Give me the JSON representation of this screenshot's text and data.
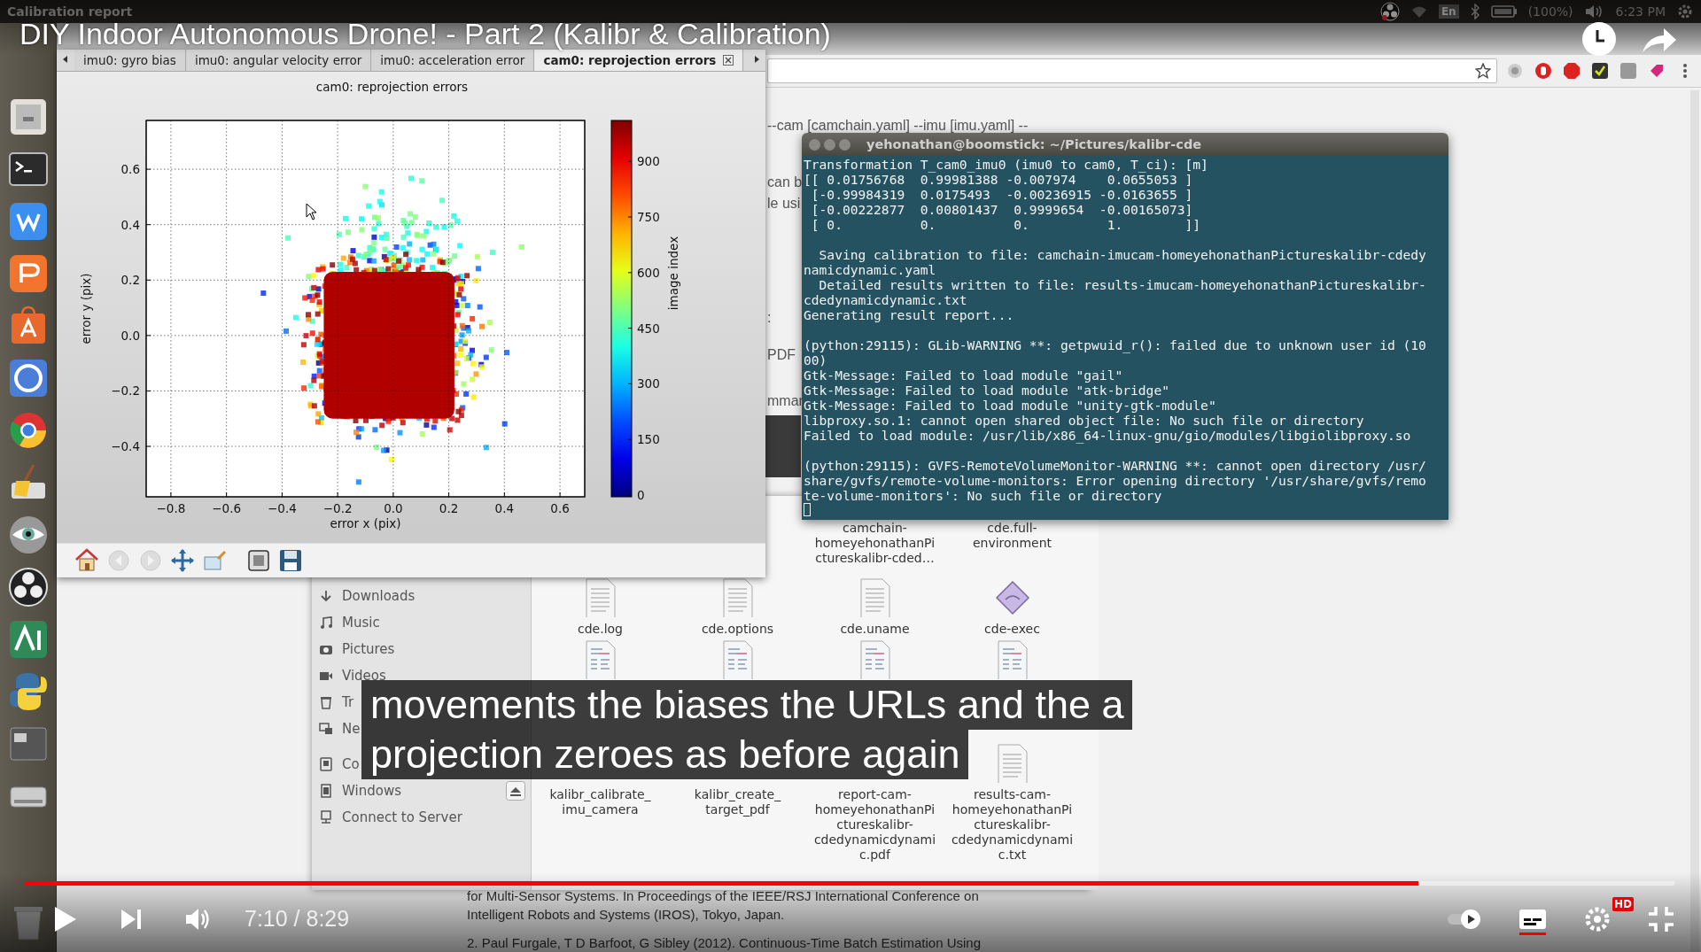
{
  "top_panel": {
    "title": "Calibration report",
    "keyboard": "En",
    "battery": "(100%)",
    "clock": "6:23 PM"
  },
  "video_title": "DIY Indoor Autonomous Drone! - Part 2 (Kalibr & Calibration)",
  "plot_window": {
    "tabs": [
      {
        "label": "imu0: gyro bias",
        "selected": false
      },
      {
        "label": "imu0: angular velocity error",
        "selected": false
      },
      {
        "label": "imu0: acceleration error",
        "selected": false
      },
      {
        "label": "cam0: reprojection errors",
        "selected": true
      }
    ],
    "plot": {
      "title": "cam0: reprojection errors",
      "xlabel": "error x (pix)",
      "ylabel": "error y (pix)",
      "xticks": [
        "−0.8",
        "−0.6",
        "−0.4",
        "−0.2",
        "0.0",
        "0.2",
        "0.4",
        "0.6"
      ],
      "yticks": [
        "0.6",
        "0.4",
        "0.2",
        "0.0",
        "−0.2",
        "−0.4"
      ],
      "colorbar": {
        "label": "image index",
        "ticks": [
          "900",
          "750",
          "600",
          "450",
          "300",
          "150",
          "0"
        ]
      }
    }
  },
  "page_fragments": [
    "--cam [camchain.yaml] --imu [imu.yaml] --",
    "can b",
    "le usi",
    ":",
    "PDF",
    "mmar"
  ],
  "terminal": {
    "title": "yehonathan@boomstick: ~/Pictures/kalibr-cde",
    "blocks": [
      [
        "Transformation T_cam0_imu0 (imu0 to cam0, T_ci): [m]",
        "[[ 0.01756768  0.99981388 -0.007974    0.0655053 ]",
        " [-0.99984319  0.0175493  -0.00236915 -0.0163655 ]",
        " [-0.00222877  0.00801437  0.9999654  -0.00165073]",
        " [ 0.          0.          0.          1.        ]]"
      ],
      [
        "  Saving calibration to file: camchain-imucam-homeyehonathanPictureskalibr-cdedy",
        "namicdynamic.yaml",
        "  Detailed results written to file: results-imucam-homeyehonathanPictureskalibr-",
        "cdedynamicdynamic.txt",
        "Generating result report..."
      ],
      [
        "(python:29115): GLib-WARNING **: getpwuid_r(): failed due to unknown user id (10",
        "00)",
        "Gtk-Message: Failed to load module \"gail\"",
        "Gtk-Message: Failed to load module \"atk-bridge\"",
        "Gtk-Message: Failed to load module \"unity-gtk-module\"",
        "libproxy.so.1: cannot open shared object file: No such file or directory",
        "Failed to load module: /usr/lib/x86_64-linux-gnu/gio/modules/libgiolibproxy.so"
      ],
      [
        "(python:29115): GVFS-RemoteVolumeMonitor-WARNING **: cannot open directory /usr/",
        "share/gvfs/remote-volume-monitors: Error opening directory '/usr/share/gvfs/remo",
        "te-volume-monitors': No such file or directory"
      ]
    ]
  },
  "file_manager": {
    "sidebar": [
      {
        "label": "Downloads",
        "kind": "download"
      },
      {
        "label": "Music",
        "kind": "music"
      },
      {
        "label": "Pictures",
        "kind": "camera"
      },
      {
        "label": "Videos",
        "kind": "video"
      },
      {
        "label": "Tr",
        "kind": "trash"
      },
      {
        "label": "Ne",
        "kind": "network"
      },
      {
        "label": "Co",
        "kind": "computer"
      },
      {
        "label": "Windows",
        "kind": "drive"
      },
      {
        "label": "Connect to Server",
        "kind": "server"
      }
    ],
    "rows": [
      [
        "",
        "",
        {
          "label": [
            "camchain-",
            "homeyehonathanPi",
            "ctureskalibr-cded…"
          ]
        },
        {
          "label": [
            "cde.full-",
            "environment"
          ]
        }
      ],
      [
        {
          "kind": "text",
          "label": [
            "cde.log"
          ]
        },
        {
          "kind": "text",
          "label": [
            "cde.options"
          ]
        },
        {
          "kind": "text",
          "label": [
            "cde.uname"
          ]
        },
        {
          "kind": "exec",
          "label": [
            "cde-exec"
          ]
        }
      ],
      [
        {
          "kind": "script"
        },
        {
          "kind": "script"
        },
        {
          "kind": "script"
        },
        {
          "kind": "script"
        }
      ],
      [
        {
          "label": [
            "kalibr_calibrate_",
            "imu_camera"
          ]
        },
        {
          "label": [
            "kalibr_create_",
            "target_pdf"
          ]
        },
        {
          "label": [
            "report-cam-",
            "homeyehonathanPi",
            "ctureskalibr-",
            "cdedynamicdynami",
            "c.pdf"
          ]
        },
        {
          "kind": "text",
          "label": [
            "results-cam-",
            "homeyehonathanPi",
            "ctureskalibr-",
            "cdedynamicdynami",
            "c.txt"
          ]
        }
      ]
    ]
  },
  "references": [
    "for Multi-Sensor Systems. In Proceedings of the IEEE/RSJ International Conference on",
    "Intelligent Robots and Systems (IROS), Tokyo, Japan.",
    "2. Paul Furgale, T D Barfoot, G Sibley (2012). Continuous-Time Batch Estimation Using"
  ],
  "subtitles": [
    "movements the biases the URLs and the a",
    "projection zeroes as before again"
  ],
  "player": {
    "progress": {
      "level": 0.845
    },
    "time": "7:10 / 8:29",
    "quality_badge": "HD"
  }
}
